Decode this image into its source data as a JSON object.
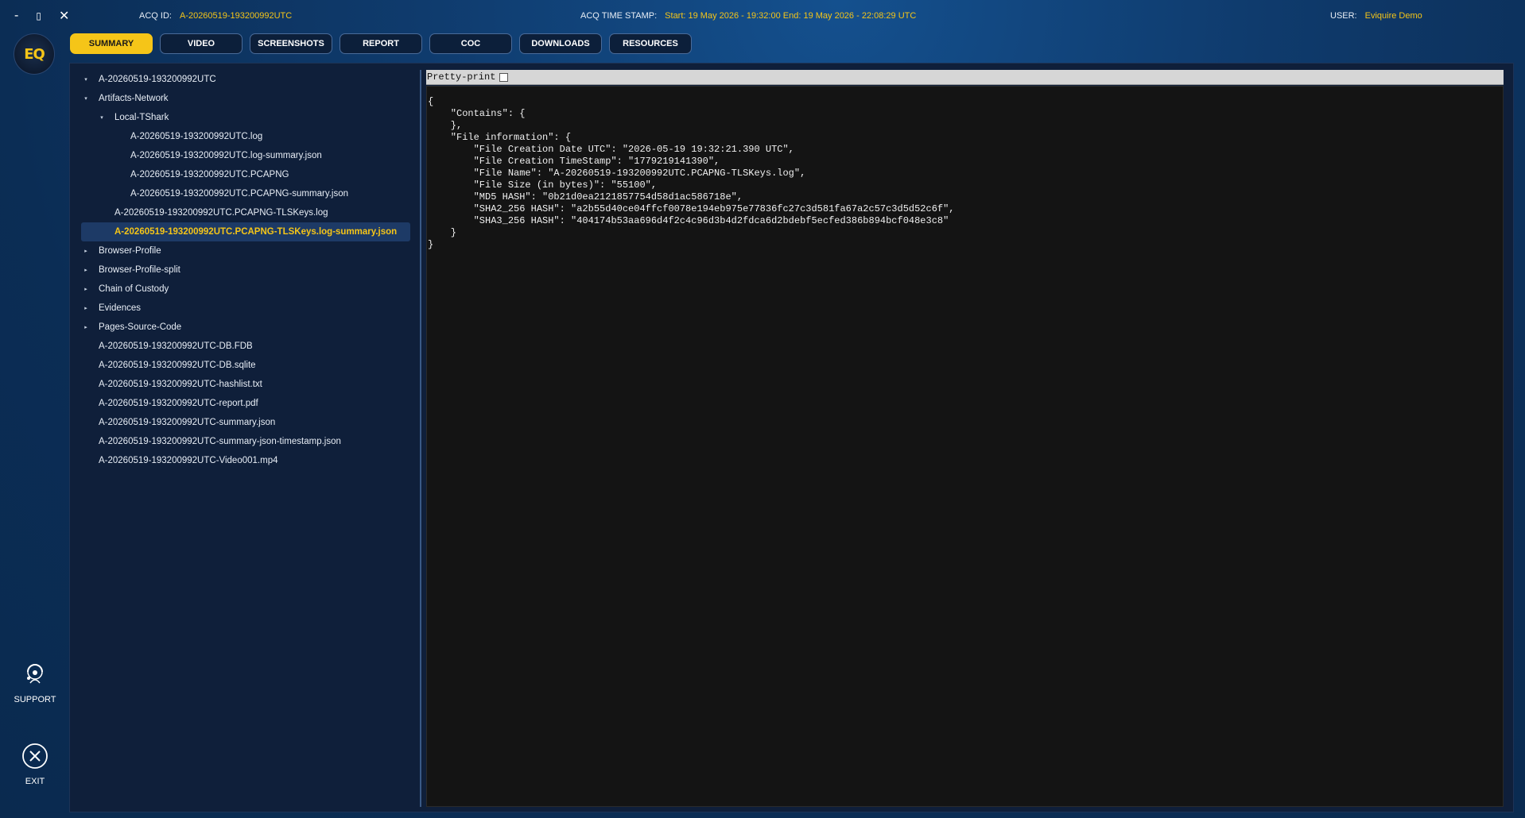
{
  "window": {
    "minimize": "-",
    "maximize": "▯",
    "close": "✕"
  },
  "header": {
    "acq_id_label": "ACQ ID:",
    "acq_id_value": "A-20260519-193200992UTC",
    "timestamp_label": "ACQ TIME STAMP:",
    "timestamp_value": "Start: 19 May 2026 - 19:32:00 End: 19 May 2026 - 22:08:29 UTC",
    "user_label": "USER:",
    "user_value": "Eviquire Demo"
  },
  "logo": {
    "text": "EQ"
  },
  "tabs": [
    {
      "label": "SUMMARY",
      "active": true
    },
    {
      "label": "VIDEO"
    },
    {
      "label": "SCREENSHOTS"
    },
    {
      "label": "REPORT"
    },
    {
      "label": "COC"
    },
    {
      "label": "DOWNLOADS"
    },
    {
      "label": "RESOURCES"
    }
  ],
  "rail": {
    "support_label": "SUPPORT",
    "exit_label": "EXIT"
  },
  "tree": [
    {
      "label": "A-20260519-193200992UTC",
      "level": 0,
      "arrow": "▾"
    },
    {
      "label": "Artifacts-Network",
      "level": 0,
      "arrow": "▾"
    },
    {
      "label": "Local-TShark",
      "level": 1,
      "arrow": "▾"
    },
    {
      "label": "A-20260519-193200992UTC.log",
      "level": 2,
      "arrow": ""
    },
    {
      "label": "A-20260519-193200992UTC.log-summary.json",
      "level": 2,
      "arrow": ""
    },
    {
      "label": "A-20260519-193200992UTC.PCAPNG",
      "level": 2,
      "arrow": ""
    },
    {
      "label": "A-20260519-193200992UTC.PCAPNG-summary.json",
      "level": 2,
      "arrow": ""
    },
    {
      "label": "A-20260519-193200992UTC.PCAPNG-TLSKeys.log",
      "level": 1,
      "arrow": ""
    },
    {
      "label": "A-20260519-193200992UTC.PCAPNG-TLSKeys.log-summary.json",
      "level": 1,
      "arrow": "",
      "selected": true
    },
    {
      "label": "Browser-Profile",
      "level": 0,
      "arrow": "▸"
    },
    {
      "label": "Browser-Profile-split",
      "level": 0,
      "arrow": "▸"
    },
    {
      "label": "Chain of Custody",
      "level": 0,
      "arrow": "▸"
    },
    {
      "label": "Evidences",
      "level": 0,
      "arrow": "▸"
    },
    {
      "label": "Pages-Source-Code",
      "level": 0,
      "arrow": "▸"
    },
    {
      "label": "A-20260519-193200992UTC-DB.FDB",
      "level": 0,
      "arrow": ""
    },
    {
      "label": "A-20260519-193200992UTC-DB.sqlite",
      "level": 0,
      "arrow": ""
    },
    {
      "label": "A-20260519-193200992UTC-hashlist.txt",
      "level": 0,
      "arrow": ""
    },
    {
      "label": "A-20260519-193200992UTC-report.pdf",
      "level": 0,
      "arrow": ""
    },
    {
      "label": "A-20260519-193200992UTC-summary.json",
      "level": 0,
      "arrow": ""
    },
    {
      "label": "A-20260519-193200992UTC-summary-json-timestamp.json",
      "level": 0,
      "arrow": ""
    },
    {
      "label": "A-20260519-193200992UTC-Video001.mp4",
      "level": 0,
      "arrow": ""
    }
  ],
  "viewer": {
    "pretty_print_label": "Pretty-print",
    "pretty_print_checked": false,
    "json_text": "{\n    \"Contains\": {\n    },\n    \"File information\": {\n        \"File Creation Date UTC\": \"2026-05-19 19:32:21.390 UTC\",\n        \"File Creation TimeStamp\": \"1779219141390\",\n        \"File Name\": \"A-20260519-193200992UTC.PCAPNG-TLSKeys.log\",\n        \"File Size (in bytes)\": \"55100\",\n        \"MD5 HASH\": \"0b21d0ea2121857754d58d1ac586718e\",\n        \"SHA2_256 HASH\": \"a2b55d40ce04ffcf0078e194eb975e77836fc27c3d581fa67a2c57c3d5d52c6f\",\n        \"SHA3_256 HASH\": \"404174b53aa696d4f2c4c96d3b4d2fdca6d2bdebf5ecfed386b894bcf048e3c8\"\n    }\n}"
  },
  "colors": {
    "accent": "#f5c518",
    "panel": "#0f1f3a",
    "selected_row": "#1d3a66"
  }
}
